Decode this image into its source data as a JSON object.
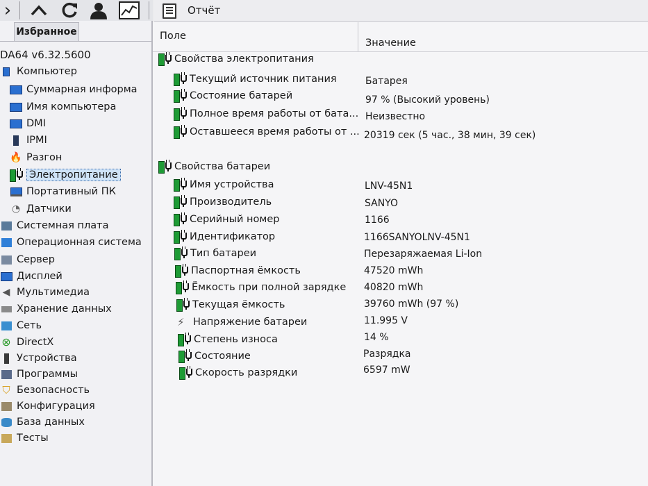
{
  "app": {
    "version": "DA64 v6.32.5600"
  },
  "report": {
    "title": "Отчёт"
  },
  "tabs": {
    "favorites": "Избранное"
  },
  "columns": {
    "field": "Поле",
    "value": "Значение"
  },
  "tree": [
    {
      "label": "Компьютер",
      "icon": "computer-icon"
    },
    {
      "label": "Суммарная информа",
      "icon": "monitor-icon"
    },
    {
      "label": "Имя компьютера",
      "icon": "monitor-icon"
    },
    {
      "label": "DMI",
      "icon": "monitor-icon"
    },
    {
      "label": "IPMI",
      "icon": "phone-icon"
    },
    {
      "label": "Разгон",
      "icon": "flame-icon"
    },
    {
      "label": "Электропитание",
      "icon": "battery-plug-icon"
    },
    {
      "label": "Портативный ПК",
      "icon": "laptop-icon"
    },
    {
      "label": "Датчики",
      "icon": "sensor-icon"
    },
    {
      "label": "Системная плата",
      "icon": "motherboard-icon"
    },
    {
      "label": "Операционная система",
      "icon": "windows-icon"
    },
    {
      "label": "Сервер",
      "icon": "server-icon"
    },
    {
      "label": "Дисплей",
      "icon": "display-icon"
    },
    {
      "label": "Мультимедиа",
      "icon": "speaker-icon"
    },
    {
      "label": "Хранение данных",
      "icon": "storage-icon"
    },
    {
      "label": "Сеть",
      "icon": "network-icon"
    },
    {
      "label": "DirectX",
      "icon": "xbox-icon"
    },
    {
      "label": "Устройства",
      "icon": "device-icon"
    },
    {
      "label": "Программы",
      "icon": "programs-icon"
    },
    {
      "label": "Безопасность",
      "icon": "shield-icon"
    },
    {
      "label": "Конфигурация",
      "icon": "config-icon"
    },
    {
      "label": "База данных",
      "icon": "database-icon"
    },
    {
      "label": "Тесты",
      "icon": "tests-icon"
    }
  ],
  "sections": [
    {
      "title": "Свойства электропитания",
      "rows": [
        {
          "field": "Текущий источник питания",
          "value": "Батарея"
        },
        {
          "field": "Состояние батарей",
          "value": "97 % (Высокий уровень)"
        },
        {
          "field": "Полное время работы от бата...",
          "value": "Неизвестно"
        },
        {
          "field": "Оставшееся время работы от ...",
          "value": "20319 сек (5 час., 38 мин, 39 сек)"
        }
      ]
    },
    {
      "title": "Свойства батареи",
      "rows": [
        {
          "field": "Имя устройства",
          "value": "LNV-45N1"
        },
        {
          "field": "Производитель",
          "value": "SANYO"
        },
        {
          "field": "Серийный номер",
          "value": "1166"
        },
        {
          "field": "Идентификатор",
          "value": "1166SANYOLNV-45N1"
        },
        {
          "field": "Тип батареи",
          "value": "Перезаряжаемая Li-Ion"
        },
        {
          "field": "Паспортная ёмкость",
          "value": "47520 mWh"
        },
        {
          "field": "Ёмкость при полной зарядке",
          "value": "40820 mWh"
        },
        {
          "field": "Текущая ёмкость",
          "value": "39760 mWh  (97 %)"
        },
        {
          "field": "Напряжение батареи",
          "value": "11.995 V",
          "icon": "voltage-icon"
        },
        {
          "field": "Степень износа",
          "value": "14 %"
        },
        {
          "field": "Состояние",
          "value": "Разрядка"
        },
        {
          "field": "Скорость разрядки",
          "value": "6597 mW"
        }
      ]
    }
  ]
}
